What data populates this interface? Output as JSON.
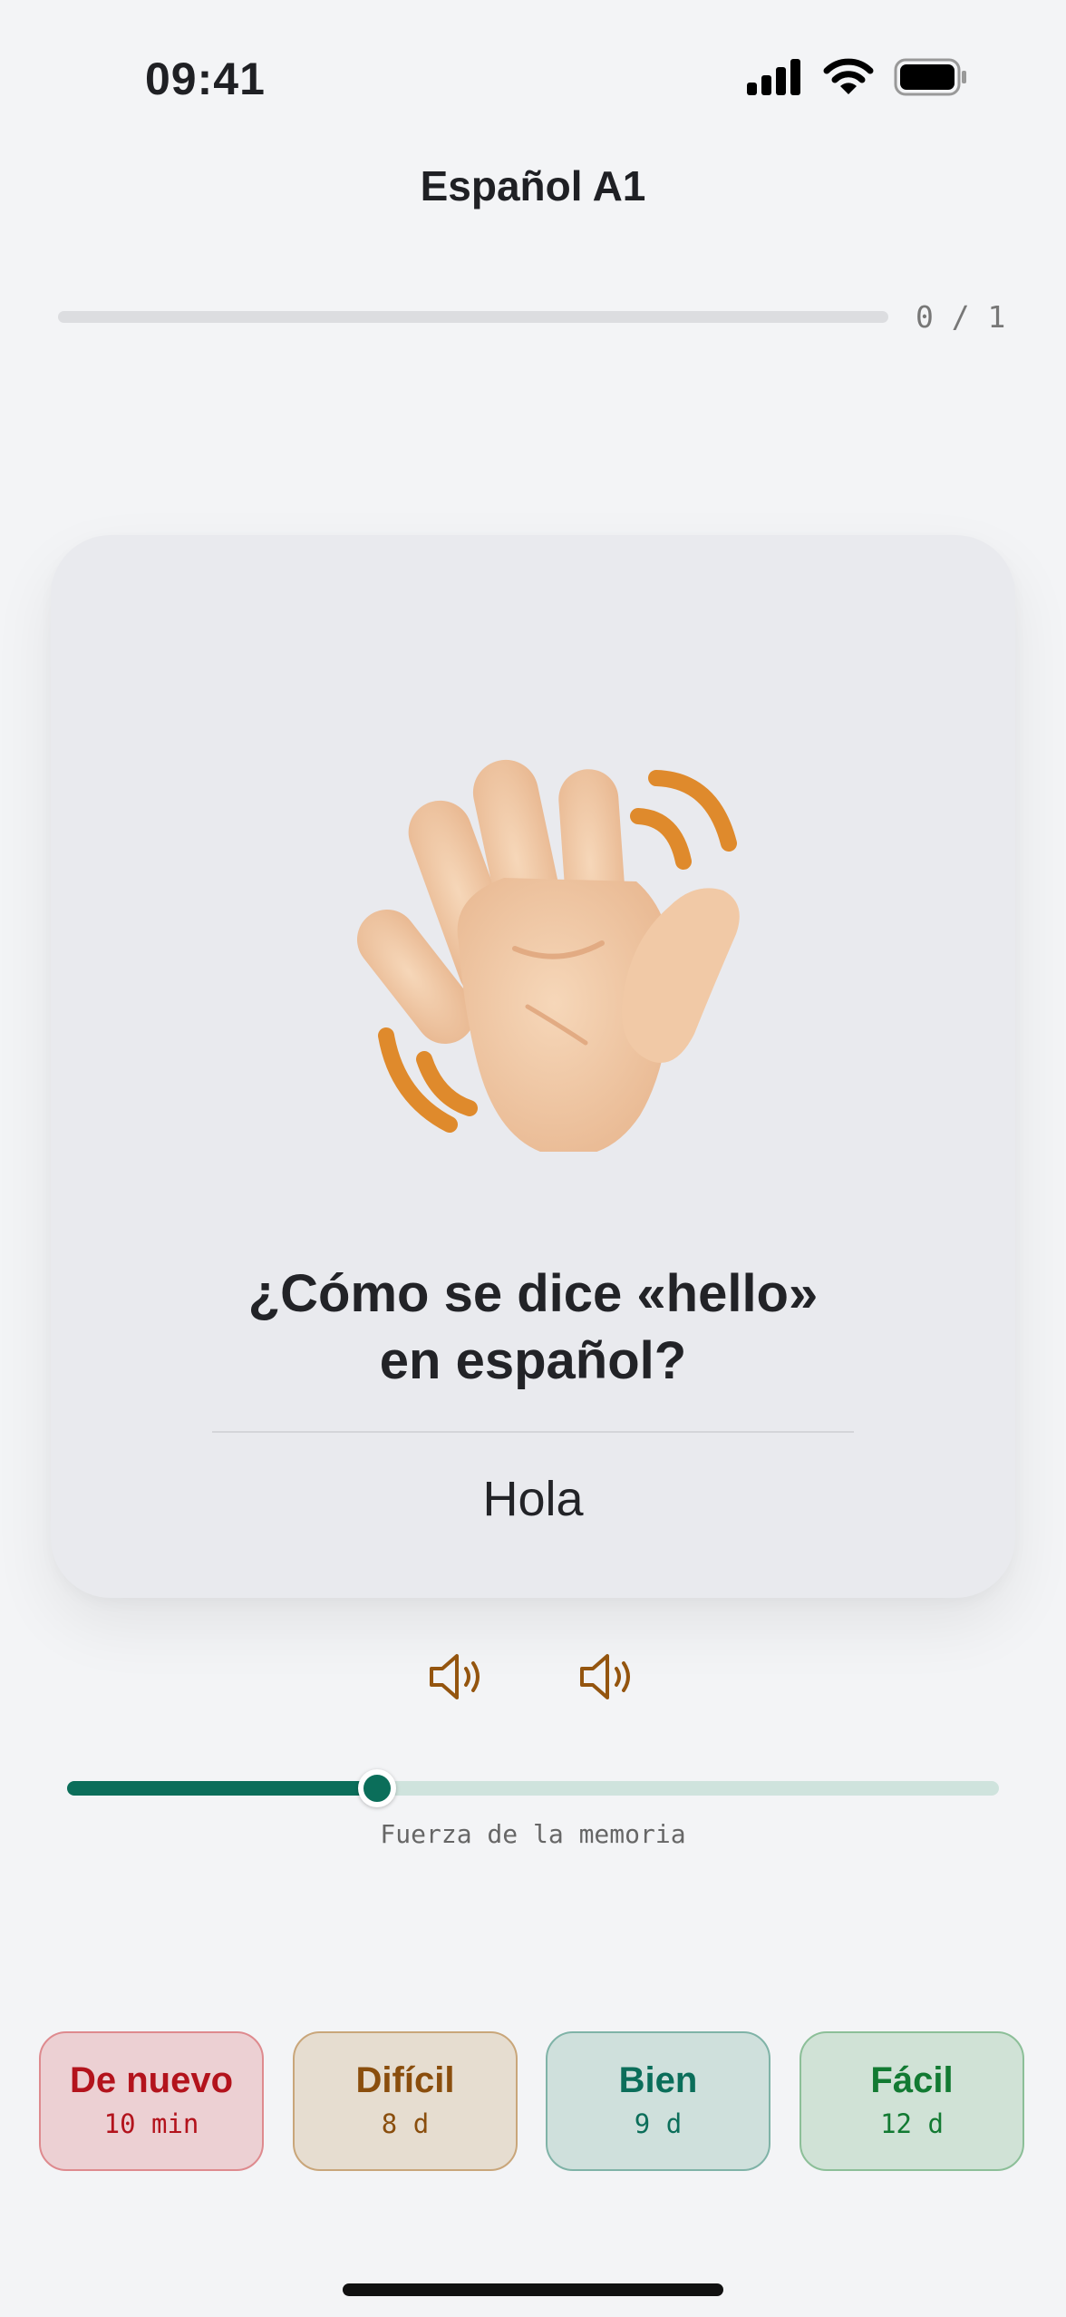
{
  "status": {
    "time": "09:41"
  },
  "header": {
    "title": "Español A1"
  },
  "progress": {
    "counter": "0 / 1",
    "fraction": 0
  },
  "card": {
    "illustration": "waving-hand",
    "question": "¿Cómo se dice «hello»\nen español?",
    "answer": "Hola"
  },
  "audio": [
    {
      "icon": "speaker-icon"
    },
    {
      "icon": "speaker-icon"
    }
  ],
  "memory": {
    "label": "Fuerza de la memoria",
    "value": 0.333
  },
  "grades": [
    {
      "label": "De nuevo",
      "interval": "10 min",
      "color": "#b3131c",
      "bg": "#ecd0d3",
      "border": "#de8a8e"
    },
    {
      "label": "Difícil",
      "interval": "8 d",
      "color": "#8a4e0d",
      "bg": "#e6ddd0",
      "border": "#c9a67a"
    },
    {
      "label": "Bien",
      "interval": "9 d",
      "color": "#0b6e5a",
      "bg": "#cfe0dc",
      "border": "#7fb3a7"
    },
    {
      "label": "Fácil",
      "interval": "12 d",
      "color": "#127a32",
      "bg": "#d0e2d6",
      "border": "#8cbf98"
    }
  ],
  "colors": {
    "accent": "#0b6e5a",
    "background": "#f3f4f6",
    "card": "#e9eaee",
    "audio": "#94550f"
  }
}
